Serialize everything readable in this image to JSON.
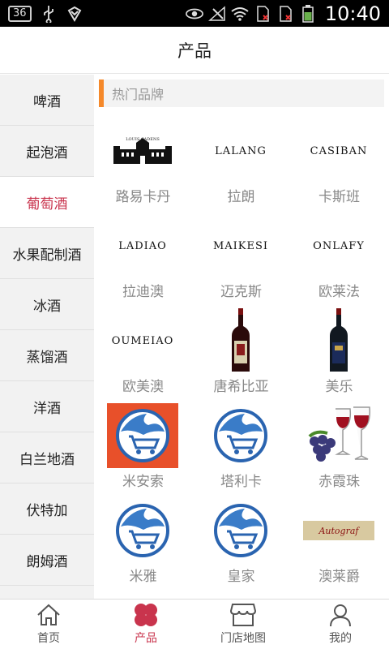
{
  "status_bar": {
    "badge": "36",
    "time": "10:40"
  },
  "header": {
    "title": "产品"
  },
  "sidebar": {
    "items": [
      {
        "label": "啤酒"
      },
      {
        "label": "起泡酒"
      },
      {
        "label": "葡萄酒",
        "active": true
      },
      {
        "label": "水果配制酒"
      },
      {
        "label": "冰酒"
      },
      {
        "label": "蒸馏酒"
      },
      {
        "label": "洋酒"
      },
      {
        "label": "白兰地酒"
      },
      {
        "label": "伏特加"
      },
      {
        "label": "朗姆酒"
      }
    ]
  },
  "main": {
    "section_title": "热门品牌",
    "brands": [
      {
        "name": "路易卡丹",
        "logo_text": "LOUIS CADENS",
        "logo": "castle-logo"
      },
      {
        "name": "拉朗",
        "logo_text": "LALANG",
        "logo": "text-logo"
      },
      {
        "name": "卡斯班",
        "logo_text": "CASIBAN",
        "logo": "text-logo"
      },
      {
        "name": "拉迪澳",
        "logo_text": "LADIAO",
        "logo": "text-logo"
      },
      {
        "name": "迈克斯",
        "logo_text": "MAIKESI",
        "logo": "text-logo"
      },
      {
        "name": "欧莱法",
        "logo_text": "ONLAFY",
        "logo": "text-logo"
      },
      {
        "name": "欧美澳",
        "logo_text": "OUMEIAO",
        "logo": "text-logo"
      },
      {
        "name": "唐希比亚",
        "logo_text": "",
        "logo": "wine-bottle-icon"
      },
      {
        "name": "美乐",
        "logo_text": "",
        "logo": "wine-bottle-icon"
      },
      {
        "name": "米安索",
        "logo_text": "",
        "logo": "cart-globe-logo-red"
      },
      {
        "name": "塔利卡",
        "logo_text": "",
        "logo": "cart-globe-logo"
      },
      {
        "name": "赤霞珠",
        "logo_text": "",
        "logo": "wine-glasses-grapes-icon"
      },
      {
        "name": "米雅",
        "logo_text": "",
        "logo": "cart-globe-logo"
      },
      {
        "name": "皇家",
        "logo_text": "",
        "logo": "cart-globe-logo"
      },
      {
        "name": "澳莱爵",
        "logo_text": "Autograf",
        "logo": "label-banner-logo"
      }
    ]
  },
  "tabbar": {
    "tabs": [
      {
        "label": "首页",
        "icon": "home-icon"
      },
      {
        "label": "产品",
        "icon": "clover-icon",
        "active": true
      },
      {
        "label": "门店地图",
        "icon": "store-icon"
      },
      {
        "label": "我的",
        "icon": "user-icon"
      }
    ]
  },
  "colors": {
    "accent": "#c9344d",
    "section_bar": "#f5892a"
  }
}
